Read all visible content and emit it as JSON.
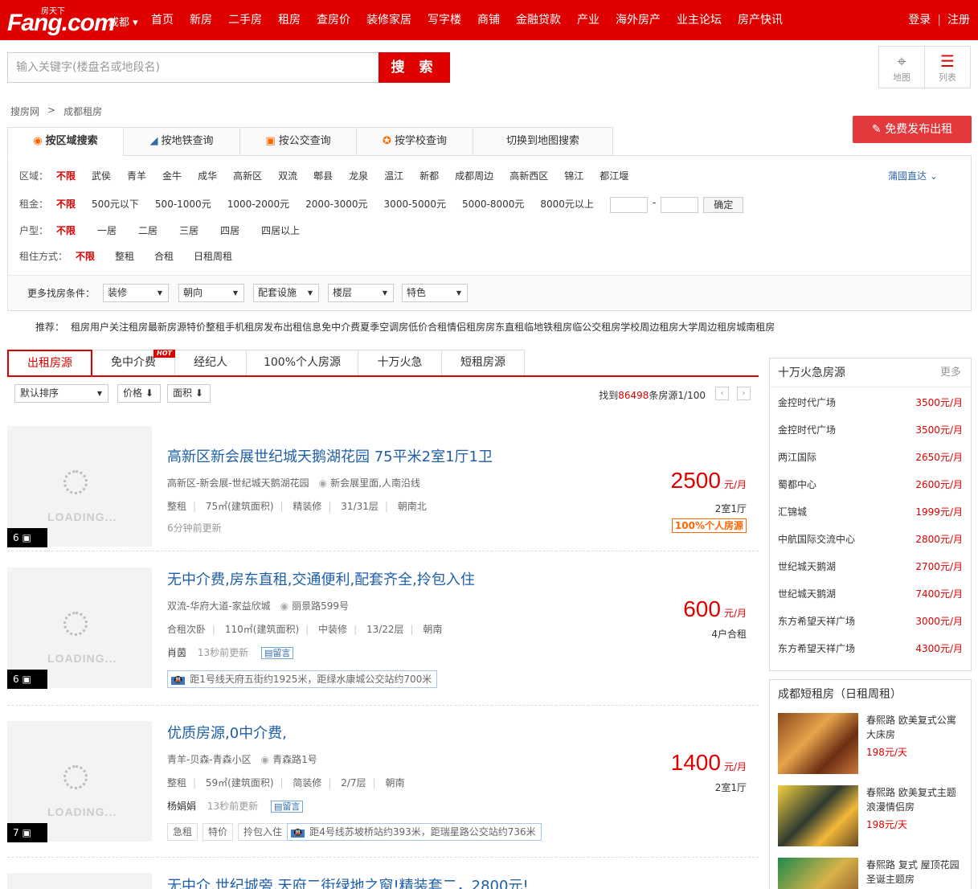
{
  "header": {
    "logo_main": "Fang.com",
    "logo_sub": "房天下",
    "city": "成都",
    "nav": [
      "首页",
      "新房",
      "二手房",
      "租房",
      "查房价",
      "装修家居",
      "写字楼",
      "商铺",
      "金融贷款",
      "产业",
      "海外房产",
      "业主论坛",
      "房产快讯"
    ],
    "login": "登录",
    "register": "注册"
  },
  "search": {
    "placeholder": "输入关键字(楼盘名或地段名)",
    "button": "搜 索"
  },
  "view_toggle": {
    "map": "地图",
    "list": "列表"
  },
  "breadcrumb": [
    "搜房网",
    ">",
    "成都租房"
  ],
  "publish_button": "免费发布出租",
  "search_tabs": [
    "按区域搜索",
    "按地铁查询",
    "按公交查询",
    "按学校查询",
    "切换到地图搜索"
  ],
  "filters": {
    "district_label": "区域：",
    "district": [
      "不限",
      "武侯",
      "青羊",
      "金牛",
      "成华",
      "高新区",
      "双流",
      "郫县",
      "龙泉",
      "温江",
      "新都",
      "成都周边",
      "高新西区",
      "锦江",
      "都江堰"
    ],
    "more_district": "蒲國直达",
    "rent_label": "租金：",
    "rent": [
      "不限",
      "500元以下",
      "500-1000元",
      "1000-2000元",
      "2000-3000元",
      "3000-5000元",
      "5000-8000元",
      "8000元以上"
    ],
    "range_sep": "-",
    "confirm": "确定",
    "room_label": "户型：",
    "room": [
      "不限",
      "一居",
      "二居",
      "三居",
      "四居",
      "四居以上"
    ],
    "mode_label": "租住方式：",
    "mode": [
      "不限",
      "整租",
      "合租",
      "日租周租"
    ],
    "more_label": "更多找房条件：",
    "more_dropdowns": [
      "装修",
      "朝向",
      "配套设施",
      "楼层",
      "特色"
    ]
  },
  "recommend": {
    "label": "推荐：",
    "items": [
      "租房用户关注",
      "租房最新房源",
      "特价整租",
      "手机租房",
      "发布出租信息",
      "免中介费",
      "夏季空调房",
      "低价合租",
      "情侣租房",
      "房东直租",
      "临地铁租房",
      "临公交租房",
      "学校周边租房",
      "大学周边租房",
      "城南租房"
    ]
  },
  "list_tabs": [
    "出租房源",
    "免中介费",
    "经纪人",
    "100%个人房源",
    "十万火急",
    "短租房源"
  ],
  "hot_badge": "HOT",
  "sort": {
    "default": "默认排序",
    "price": "价格",
    "area": "面积",
    "found_prefix": "找到",
    "found_count": "86498",
    "found_suffix": "条房源1/100"
  },
  "loading_text": "LOADING...",
  "listings": [
    {
      "photos": "6",
      "title": "高新区新会展世纪城天鹅湖花园 75平米2室1厅1卫",
      "location": "高新区-新会展-世纪城天鹅湖花园",
      "address": "新会展里面,人南沿线",
      "specs": [
        "整租",
        "75㎡(建筑面积)",
        "精装修",
        "31/31层",
        "朝南北"
      ],
      "meta": "6分钟前更新",
      "price": "2500",
      "unit": "元/月",
      "layout": "2室1厅",
      "badge": "100%个人房源"
    },
    {
      "photos": "6",
      "title": "无中介费,房东直租,交通便利,配套齐全,拎包入住",
      "location": "双流-华府大道-家益欣城",
      "address": "丽景路599号",
      "specs": [
        "合租次卧",
        "110㎡(建筑面积)",
        "中装修",
        "13/22层",
        "朝南"
      ],
      "agent": "肖茵",
      "meta": "13秒前更新",
      "msg": "留言",
      "transit": "距1号线天府五街约1925米，距绿水康城公交站约700米",
      "price": "600",
      "unit": "元/月",
      "layout": "4户合租"
    },
    {
      "photos": "7",
      "title": "优质房源,0中介费,",
      "location": "青羊-贝森-青森小区",
      "address": "青森路1号",
      "specs": [
        "整租",
        "59㎡(建筑面积)",
        "简装修",
        "2/7层",
        "朝南"
      ],
      "agent": "杨娟娟",
      "meta": "13秒前更新",
      "msg": "留言",
      "tags": [
        "急租",
        "特价",
        "拎包入住"
      ],
      "transit": "距4号线苏坡桥站约393米，距瑞星路公交站约736米",
      "price": "1400",
      "unit": "元/月",
      "layout": "2室1厅"
    },
    {
      "title": "无中介,世纪城旁,天府二街绿地之窗!精装套二，2800元!"
    }
  ],
  "urgent": {
    "title": "十万火急房源",
    "more": "更多",
    "items": [
      {
        "name": "金控时代广场",
        "price": "3500元/月"
      },
      {
        "name": "金控时代广场",
        "price": "3500元/月"
      },
      {
        "name": "两江国际",
        "price": "2650元/月"
      },
      {
        "name": "蜀都中心",
        "price": "2600元/月"
      },
      {
        "name": "汇锦城",
        "price": "1999元/月"
      },
      {
        "name": "中航国际交流中心",
        "price": "2800元/月"
      },
      {
        "name": "世纪城天鹅湖",
        "price": "2700元/月"
      },
      {
        "name": "世纪城天鹅湖",
        "price": "7400元/月"
      },
      {
        "name": "东方希望天祥广场",
        "price": "3000元/月"
      },
      {
        "name": "东方希望天祥广场",
        "price": "4300元/月"
      }
    ]
  },
  "short_rent": {
    "title": "成都短租房（日租周租）",
    "items": [
      {
        "name": "春熙路 欧美复式公寓 大床房",
        "price": "198元/天"
      },
      {
        "name": "春熙路 欧美复式主题 浪漫情侣房",
        "price": "198元/天"
      },
      {
        "name": "春熙路 复式 屋顶花园 圣诞主题房",
        "price": ""
      }
    ]
  }
}
